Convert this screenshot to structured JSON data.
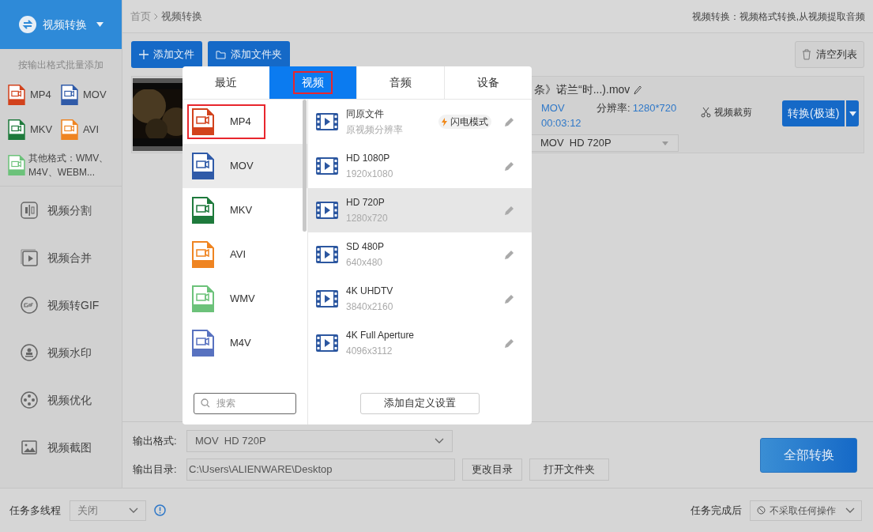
{
  "sidebar": {
    "header": {
      "label": "视频转换"
    },
    "batch_title": "按输出格式批量添加",
    "formats": [
      {
        "label": "MP4",
        "color": "#d2421c"
      },
      {
        "label": "MOV",
        "color": "#2f5aa8"
      },
      {
        "label": "MKV",
        "color": "#1e7a3c"
      },
      {
        "label": "AVI",
        "color": "#ef8421"
      }
    ],
    "other_formats": {
      "label": "其他格式：WMV、M4V、WEBM...",
      "color": "#6cc27a"
    },
    "tools": [
      {
        "label": "视频分割"
      },
      {
        "label": "视频合并"
      },
      {
        "label": "视频转GIF"
      },
      {
        "label": "视频水印"
      },
      {
        "label": "视频优化"
      },
      {
        "label": "视频截图"
      }
    ]
  },
  "breadcrumb": [
    "首页",
    "视频转换"
  ],
  "header_note": "视频转换：视频格式转换,从视频提取音频",
  "toolbar": {
    "add_file": "添加文件",
    "add_folder": "添加文件夹",
    "clear": "清空列表"
  },
  "file": {
    "name": "条》诺兰“时...).mov",
    "format": "MOV",
    "duration": "00:03:12",
    "resolution_label": "分辨率:",
    "resolution": "1280*720",
    "crop": "视频裁剪",
    "convert": "转换(极速)",
    "output": "MOV  HD 720P"
  },
  "popup": {
    "tabs": [
      {
        "label": "最近",
        "selected": false
      },
      {
        "label": "视频",
        "selected": true
      },
      {
        "label": "音频",
        "selected": false
      },
      {
        "label": "设备",
        "selected": false
      }
    ],
    "formats": [
      {
        "label": "MP4",
        "color": "#d2421c",
        "selected": true,
        "hovered": false
      },
      {
        "label": "MOV",
        "color": "#2f5aa8",
        "selected": false,
        "hovered": true
      },
      {
        "label": "MKV",
        "color": "#1e7a3c",
        "selected": false,
        "hovered": false
      },
      {
        "label": "AVI",
        "color": "#ef8421",
        "selected": false,
        "hovered": false
      },
      {
        "label": "WMV",
        "color": "#6cc27a",
        "selected": false,
        "hovered": false
      },
      {
        "label": "M4V",
        "color": "#5872c0",
        "selected": false,
        "hovered": false
      }
    ],
    "search": {
      "placeholder": "搜索"
    },
    "presets": [
      {
        "name": "同原文件",
        "detail": "原视频分辨率",
        "badge": "闪电模式",
        "hovered": false
      },
      {
        "name": "HD 1080P",
        "detail": "1920x1080",
        "hovered": false
      },
      {
        "name": "HD 720P",
        "detail": "1280x720",
        "hovered": true
      },
      {
        "name": "SD 480P",
        "detail": "640x480",
        "hovered": false
      },
      {
        "name": "4K UHDTV",
        "detail": "3840x2160",
        "hovered": false
      },
      {
        "name": "4K Full Aperture",
        "detail": "4096x3112",
        "hovered": false
      }
    ],
    "custom_button": "添加自定义设置"
  },
  "output": {
    "format_label": "输出格式:",
    "format": "MOV  HD 720P",
    "dir_label": "输出目录:",
    "dir": "C:\\Users\\ALIENWARE\\Desktop",
    "change_dir": "更改目录",
    "open_folder": "打开文件夹",
    "convert_all": "全部转换"
  },
  "status_bar": {
    "threads_label": "任务多线程",
    "threads": "关闭",
    "after_label": "任务完成后",
    "after": "不采取任何操作"
  }
}
